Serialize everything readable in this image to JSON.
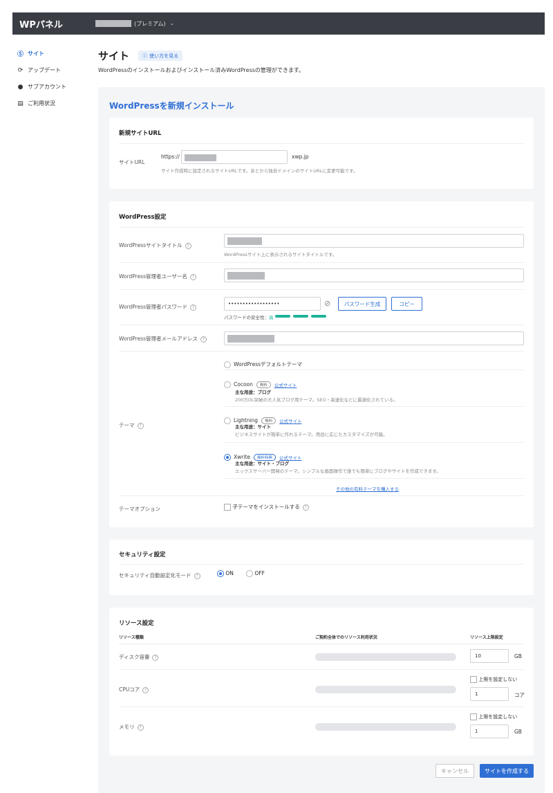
{
  "app": {
    "logo": "WPパネル",
    "plan": "(プレミアム)"
  },
  "sidebar": {
    "items": [
      {
        "label": "サイト",
        "icon": "wordpress-icon"
      },
      {
        "label": "アップデート",
        "icon": "refresh-icon"
      },
      {
        "label": "サブアカウント",
        "icon": "user-icon"
      },
      {
        "label": "ご利用状況",
        "icon": "usage-chart-icon"
      }
    ]
  },
  "header": {
    "title": "サイト",
    "howto": "使い方を見る",
    "lead": "WordPressのインストールおよびインストール済みWordPressの管理ができます。"
  },
  "form": {
    "title": "WordPressを新規インストール"
  },
  "url_section": {
    "title": "新規サイトURL",
    "label": "サイトURL",
    "prefix": "https://",
    "suffix": "xwp.jp",
    "hint": "サイト作成時に設定されるサイトURLです。あとから独自ドメインのサイトURLに変更可能です。"
  },
  "wp_settings": {
    "title": "WordPress設定",
    "site_title_label": "WordPressサイトタイトル",
    "site_title_hint": "WordPressサイト上に表示されるサイトタイトルです。",
    "admin_user_label": "WordPress管理者ユーザー名",
    "admin_pass_label": "WordPress管理者パスワード",
    "admin_pass_value": "••••••••••••••••••",
    "gen_password": "パスワード生成",
    "copy": "コピー",
    "strength_label": "パスワードの安全性：",
    "strength_value": "高",
    "admin_email_label": "WordPress管理者メールアドレス",
    "theme_label": "テーマ",
    "themes": [
      {
        "name": "WordPressデフォルトテーマ"
      },
      {
        "name": "Cocoon",
        "badge": "無料",
        "link": "公式サイト",
        "use_prefix": "主な用途：",
        "use": "ブログ",
        "desc": "200万DL突破の大人気ブログ用テーマ。SEO・高速化などに最適化されている。"
      },
      {
        "name": "Lightning",
        "badge": "無料",
        "link": "公式サイト",
        "use_prefix": "主な用途：",
        "use": "サイト",
        "desc": "ビジネスサイトが簡単に作れるテーマ。用途に応じたカスタマイズが可能。"
      },
      {
        "name": "Xwrite",
        "badge": "無料特典",
        "link": "公式サイト",
        "use_prefix": "主な用途：",
        "use": "サイト・ブログ",
        "desc": "エックスサーバー開発のテーマ。シンプルな画面操作で誰でも簡単にブログやサイトを作成できます。"
      }
    ],
    "more_themes": "その他の有料テーマを購入する",
    "theme_option_label": "テーマオプション",
    "child_theme": "子テーマをインストールする"
  },
  "security": {
    "title": "セキュリティ設定",
    "label": "セキュリティ自動設定化モード",
    "on": "ON",
    "off": "OFF"
  },
  "resources": {
    "title": "リソース設定",
    "col_type": "リソース種類",
    "col_usage": "ご契約全体でのリソース利用状況",
    "col_limit": "リソース上限設定",
    "disk_label": "ディスク容量",
    "disk_value": "10",
    "disk_unit": "GB",
    "cpu_label": "CPUコア",
    "cpu_nolimit": "上限を設定しない",
    "cpu_value": "1",
    "cpu_unit": "コア",
    "mem_label": "メモリ",
    "mem_nolimit": "上限を設定しない",
    "mem_value": "1",
    "mem_unit": "GB"
  },
  "actions": {
    "cancel": "キャンセル",
    "create": "サイトを作成する"
  },
  "colors": {
    "accent": "#2f6fd4",
    "topbar": "#3a3d44",
    "strength": "#1fb39a"
  }
}
